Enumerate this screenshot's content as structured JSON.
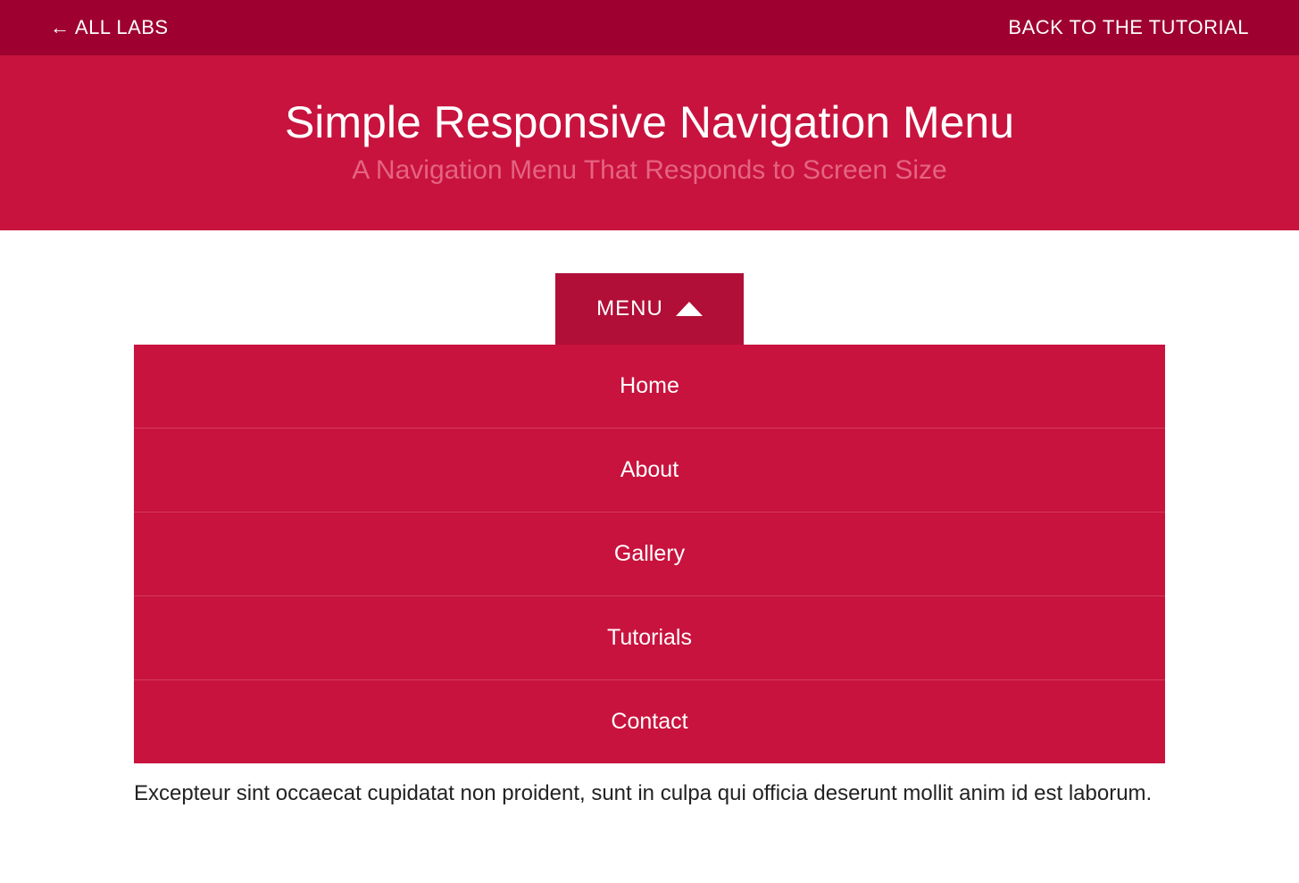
{
  "topbar": {
    "left_label": "← ALL LABS",
    "right_label": "BACK TO THE TUTORIAL"
  },
  "hero": {
    "title": "Simple Responsive Navigation Menu",
    "subtitle": "A Navigation Menu That Responds to Screen Size"
  },
  "menu": {
    "toggle_label": "MENU",
    "items": [
      {
        "label": "Home"
      },
      {
        "label": "About"
      },
      {
        "label": "Gallery"
      },
      {
        "label": "Tutorials"
      },
      {
        "label": "Contact"
      }
    ]
  },
  "body": {
    "paragraph": "Excepteur sint occaecat cupidatat non proident, sunt in culpa qui officia deserunt mollit anim id est laborum."
  }
}
